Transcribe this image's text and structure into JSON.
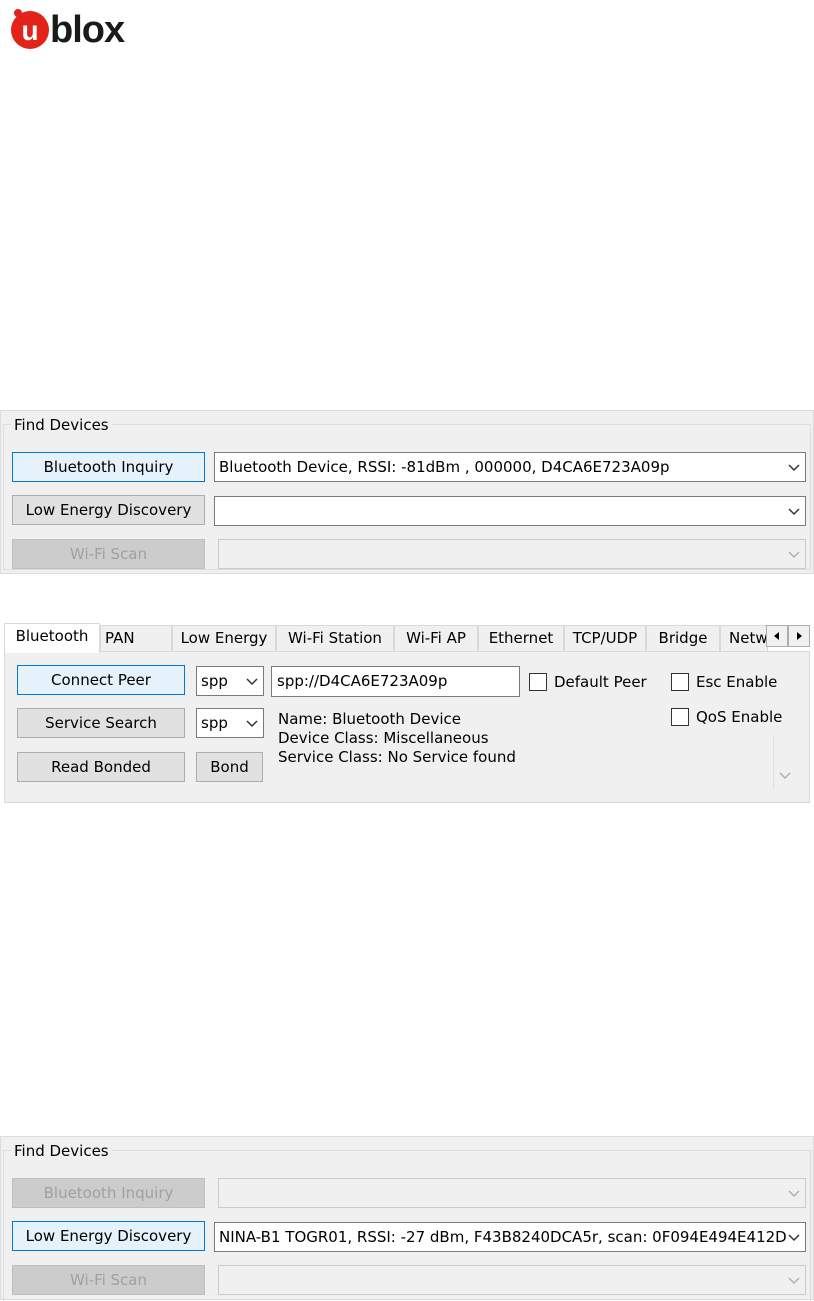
{
  "brand": {
    "logo_text": "ublox",
    "logo_letter": "u",
    "accent": "#e2231a"
  },
  "find_devices_top": {
    "title": "Find Devices",
    "bt_button": "Bluetooth Inquiry",
    "bt_value": "Bluetooth Device, RSSI: -81dBm , 000000, D4CA6E723A09p",
    "le_button": "Low Energy Discovery",
    "le_value": "",
    "wifi_button": "Wi-Fi Scan",
    "wifi_value": ""
  },
  "tabs": {
    "items": [
      "Bluetooth",
      "PAN",
      "Low Energy",
      "Wi-Fi Station",
      "Wi-Fi AP",
      "Ethernet",
      "TCP/UDP",
      "Bridge",
      "Netw"
    ],
    "active": "Bluetooth"
  },
  "bluetooth_tab": {
    "connect_peer": "Connect Peer",
    "service_search": "Service Search",
    "read_bonded": "Read Bonded",
    "bond": "Bond",
    "profile1": "spp",
    "profile2": "spp",
    "peer_url": "spp://D4CA6E723A09p",
    "default_peer": "Default Peer",
    "esc_enable": "Esc Enable",
    "qos_enable": "QoS Enable",
    "info_name": "Name: Bluetooth Device",
    "info_class": "Device Class: Miscellaneous",
    "info_service": "Service Class: No Service found"
  },
  "find_devices_bottom": {
    "title": "Find Devices",
    "bt_button": "Bluetooth Inquiry",
    "bt_value": "",
    "le_button": "Low Energy Discovery",
    "le_value": "NINA-B1 TOGR01, RSSI: -27 dBm, F43B8240DCA5r, scan: 0F094E494E412D",
    "wifi_button": "Wi-Fi Scan",
    "wifi_value": ""
  }
}
